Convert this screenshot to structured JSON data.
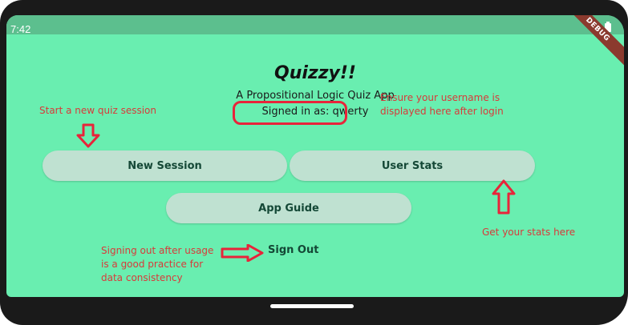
{
  "status_bar": {
    "time": "7:42"
  },
  "debug_banner": "DEBUG",
  "app": {
    "title": "Quizzy!!",
    "subtitle": "A Propositional Logic Quiz App",
    "signed_in_text": "Signed in as: qwerty"
  },
  "buttons": {
    "new_session": "New Session",
    "user_stats": "User Stats",
    "app_guide": "App Guide",
    "sign_out": "Sign Out"
  },
  "annotations": {
    "start": "Start a new quiz session",
    "ensure": "Ensure your username is displayed here after login",
    "stats": "Get your stats here",
    "signout": "Signing out after usage is a good practice for data consistency"
  },
  "colors": {
    "background": "#69eeb0",
    "button": "#bfe1d1",
    "annotation": "#d83a3a"
  }
}
